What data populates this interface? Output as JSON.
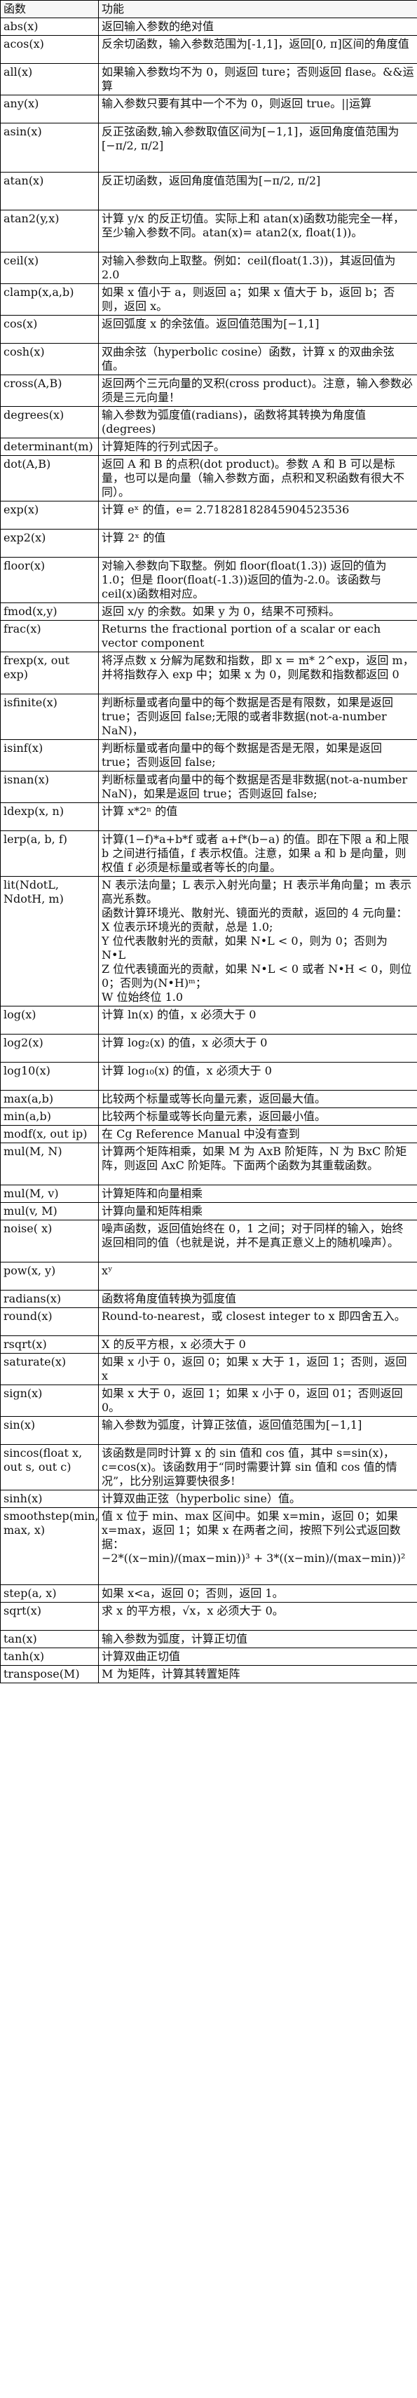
{
  "header": {
    "col_func": "函数",
    "col_desc": "功能"
  },
  "rows": [
    {
      "name": "abs(x)",
      "desc": "返回输入参数的绝对值"
    },
    {
      "name": "acos(x)",
      "desc": "反余切函数，输入参数范围为[-1,1]，返回[0, π]区间的角度值"
    },
    {
      "name": "all(x)",
      "desc": "如果输入参数均不为 0，则返回 ture；否则返回 flase。&&运算"
    },
    {
      "name": "any(x)",
      "desc": "输入参数只要有其中一个不为 0，则返回 true。||运算"
    },
    {
      "name": "asin(x)",
      "desc": "反正弦函数,输入参数取值区间为[−1,1]，返回角度值范围为[−π/2, π/2]"
    },
    {
      "name": "atan(x)",
      "desc": "反正切函数，返回角度值范围为[−π/2, π/2]"
    },
    {
      "name": "atan2(y,x)",
      "desc": "计算 y/x 的反正切值。实际上和 atan(x)函数功能完全一样，至少输入参数不同。atan(x)= atan2(x, float(1))。"
    },
    {
      "name": "ceil(x)",
      "desc": "对输入参数向上取整。例如：ceil(float(1.3))，其返回值为 2.0"
    },
    {
      "name": "clamp(x,a,b)",
      "desc": "如果 x 值小于 a，则返回 a；如果 x 值大于 b，返回 b；否则，返回 x。"
    },
    {
      "name": "cos(x)",
      "desc": "返回弧度 x 的余弦值。返回值范围为[−1,1]"
    },
    {
      "name": "cosh(x)",
      "desc": "双曲余弦（hyperbolic cosine）函数，计算 x 的双曲余弦值。"
    },
    {
      "name": "cross(A,B)",
      "desc": "返回两个三元向量的叉积(cross product)。注意，输入参数必须是三元向量！"
    },
    {
      "name": "degrees(x)",
      "desc": "输入参数为弧度值(radians)，函数将其转换为角度值(degrees)"
    },
    {
      "name": "determinant(m)",
      "desc": "计算矩阵的行列式因子。"
    },
    {
      "name": "dot(A,B)",
      "desc": "返回 A 和 B 的点积(dot product)。参数 A 和 B 可以是标量，也可以是向量（输入参数方面，点积和叉积函数有很大不同）。"
    },
    {
      "name": "exp(x)",
      "desc": "计算 eˣ 的值，e= 2.71828182845904523536"
    },
    {
      "name": "exp2(x)",
      "desc": "计算 2ˣ 的值"
    },
    {
      "name": "floor(x)",
      "desc": "对输入参数向下取整。例如 floor(float(1.3)) 返回的值为 1.0；但是 floor(float(-1.3))返回的值为-2.0。该函数与 ceil(x)函数相对应。"
    },
    {
      "name": "fmod(x,y)",
      "desc": "返回 x/y 的余数。如果 y 为 0，结果不可预料。"
    },
    {
      "name": "frac(x)",
      "desc": "Returns the fractional portion of a scalar or each vector component"
    },
    {
      "name": "frexp(x, out exp)",
      "desc": "将浮点数 x 分解为尾数和指数，即 x = m* 2^exp，返回 m，并将指数存入 exp 中；如果 x 为 0，则尾数和指数都返回 0"
    },
    {
      "name": "isfinite(x)",
      "desc": "判断标量或者向量中的每个数据是否是有限数，如果是返回 true；否则返回 false;无限的或者非数据(not-a-number NaN)，"
    },
    {
      "name": "isinf(x)",
      "desc": "判断标量或者向量中的每个数据是否是无限，如果是返回 true；否则返回 false;"
    },
    {
      "name": "isnan(x)",
      "desc": "判断标量或者向量中的每个数据是否是非数据(not-a-number NaN)，如果是返回 true；否则返回 false;"
    },
    {
      "name": "ldexp(x, n)",
      "desc": "计算 x*2ⁿ 的值"
    },
    {
      "name": "lerp(a, b, f)",
      "desc": "计算(1−f)*a+b*f 或者 a+f*(b−a) 的值。即在下限 a 和上限 b 之间进行插值，f 表示权值。注意，如果 a 和 b 是向量，则权值 f 必须是标量或者等长的向量。"
    },
    {
      "name": "lit(NdotL, NdotH, m)",
      "desc": "N 表示法向量；L 表示入射光向量；H 表示半角向量；m 表示高光系数。\n函数计算环境光、散射光、镜面光的贡献，返回的 4 元向量：\nX 位表示环境光的贡献，总是 1.0;\nY 位代表散射光的贡献，如果 N•L < 0，则为 0；否则为 N•L\nZ 位代表镜面光的贡献，如果 N•L < 0 或者 N•H < 0，则位 0；否则为(N•H)ᵐ；\nW 位始终位 1.0"
    },
    {
      "name": "log(x)",
      "desc": "计算 ln(x) 的值，x 必须大于 0"
    },
    {
      "name": "log2(x)",
      "desc": "计算 log₂(x) 的值，x 必须大于 0"
    },
    {
      "name": "log10(x)",
      "desc": "计算 log₁₀(x) 的值，x 必须大于 0"
    },
    {
      "name": "max(a,b)",
      "desc": "比较两个标量或等长向量元素，返回最大值。"
    },
    {
      "name": "min(a,b)",
      "desc": "比较两个标量或等长向量元素，返回最小值。"
    },
    {
      "name": "modf(x, out ip)",
      "desc": "在 Cg Reference Manual 中没有查到"
    },
    {
      "name": "mul(M, N)",
      "desc": "计算两个矩阵相乘，如果 M 为 AxB 阶矩阵，N 为 BxC 阶矩阵，则返回 AxC 阶矩阵。下面两个函数为其重载函数。"
    },
    {
      "name": "mul(M, v)",
      "desc": "计算矩阵和向量相乘"
    },
    {
      "name": "mul(v, M)",
      "desc": "计算向量和矩阵相乘"
    },
    {
      "name": "noise( x)",
      "desc": "噪声函数，返回值始终在 0，1 之间；对于同样的输入，始终返回相同的值（也就是说，并不是真正意义上的随机噪声）。"
    },
    {
      "name": "pow(x, y)",
      "desc": "xʸ"
    },
    {
      "name": "radians(x)",
      "desc": "函数将角度值转换为弧度值"
    },
    {
      "name": "round(x)",
      "desc": "Round-to-nearest，或 closest integer to x 即四舍五入。"
    },
    {
      "name": "rsqrt(x)",
      "desc": "X 的反平方根，x 必须大于 0"
    },
    {
      "name": "saturate(x)",
      "desc": "如果 x 小于 0，返回 0；如果 x 大于 1，返回 1；否则，返回 x"
    },
    {
      "name": "sign(x)",
      "desc": "如果 x 大于 0，返回 1；如果 x 小于 0，返回 01；否则返回 0。"
    },
    {
      "name": "sin(x)",
      "desc": "输入参数为弧度，计算正弦值，返回值范围为[−1,1]"
    },
    {
      "name": "sincos(float x, out s, out c)",
      "desc": "该函数是同时计算 x 的 sin 值和 cos 值，其中 s=sin(x)，c=cos(x)。该函数用于“同时需要计算 sin 值和 cos 值的情况”，比分别运算要快很多!"
    },
    {
      "name": "sinh(x)",
      "desc": "计算双曲正弦（hyperbolic sine）值。"
    },
    {
      "name": "smoothstep(min, max, x)",
      "desc": "值 x 位于 min、max 区间中。如果 x=min，返回 0；如果 x=max，返回 1；如果 x 在两者之间，按照下列公式返回数据：\n−2*((x−min)/(max−min))³ + 3*((x−min)/(max−min))²"
    },
    {
      "name": "step(a, x)",
      "desc": "如果 x<a，返回 0；否则，返回 1。"
    },
    {
      "name": "sqrt(x)",
      "desc": "求 x 的平方根，√x，x 必须大于 0。"
    },
    {
      "name": "tan(x)",
      "desc": "输入参数为弧度，计算正切值"
    },
    {
      "name": "tanh(x)",
      "desc": "计算双曲正切值"
    },
    {
      "name": "transpose(M)",
      "desc": "M 为矩阵，计算其转置矩阵"
    }
  ]
}
